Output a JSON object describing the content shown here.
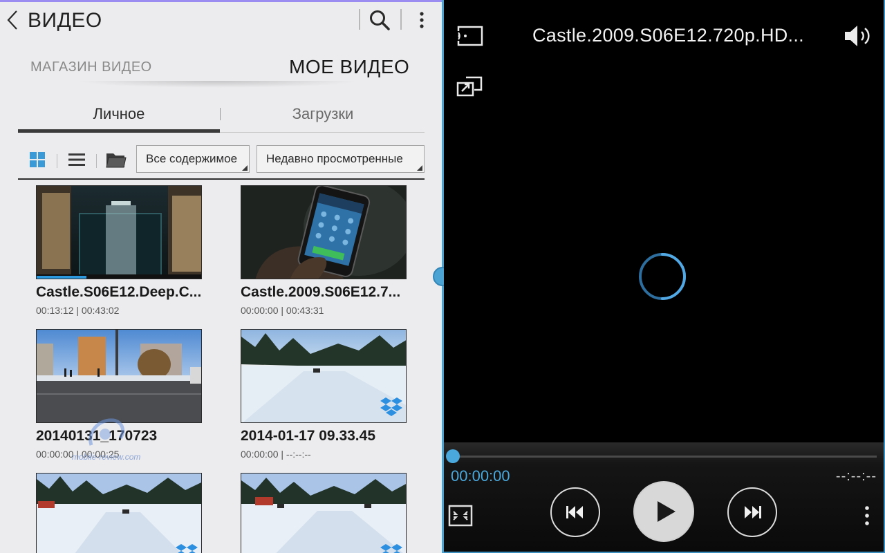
{
  "left": {
    "app_title": "ВИДЕО",
    "store_tabs": {
      "shop": "МАГАЗИН ВИДЕО",
      "my": "МОЕ ВИДЕО"
    },
    "sub_tabs": {
      "personal": "Личное",
      "downloads": "Загрузки"
    },
    "filters": {
      "content": "Все содержимое",
      "sort": "Недавно просмотренные"
    },
    "videos": [
      {
        "title": "Castle.S06E12.Deep.C...",
        "meta": "00:13:12 | 00:43:02",
        "progress": 0.3
      },
      {
        "title": "Castle.2009.S06E12.7...",
        "meta": "00:00:00 | 00:43:31"
      },
      {
        "title": "20140131_170723",
        "meta": "00:00:00 | 00:00:25"
      },
      {
        "title": "2014-01-17 09.33.45",
        "meta": "00:00:00 | --:--:--",
        "badge_icon": "dropbox-icon"
      },
      {
        "title": "",
        "meta": "",
        "badge_icon": "dropbox-icon"
      },
      {
        "title": "",
        "meta": "",
        "badge_icon": "dropbox-icon"
      }
    ],
    "watermark": "mobile-review.com"
  },
  "player": {
    "title": "Castle.2009.S06E12.720p.HD...",
    "time_current": "00:00:00",
    "time_total": "--:--:--",
    "progress": 0
  },
  "colors": {
    "accent": "#4aa8dc",
    "divider": "#4aa3d3"
  }
}
